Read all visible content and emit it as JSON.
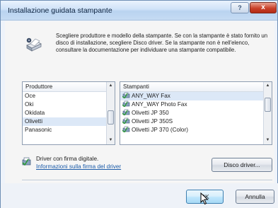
{
  "window": {
    "title": "Installazione guidata stampante",
    "help_label": "?",
    "close_label": "x"
  },
  "intro_text": "Scegliere produttore e modello della stampante. Se con la stampante è stato fornito un disco di installazione, scegliere Disco driver. Se la stampante non è nell'elenco, consultare la documentazione per individuare una stampante compatibile.",
  "manufacturers": {
    "header": "Produttore",
    "items": [
      "Oce",
      "Oki",
      "Okidata",
      "Olivetti",
      "Panasonic"
    ],
    "selected": "Olivetti"
  },
  "printers": {
    "header": "Stampanti",
    "items": [
      "ANY_WAY Fax",
      "ANY_WAY Photo Fax",
      "Olivetti JP 350",
      "Olivetti JP 350S",
      "Olivetti JP 370 (Color)"
    ],
    "selected": "ANY_WAY Fax"
  },
  "driver": {
    "signed_text": "Driver con firma digitale.",
    "link_text": "Informazioni sulla firma del driver",
    "disk_button": "Disco driver..."
  },
  "buttons": {
    "ok": "OK",
    "cancel": "Annulla"
  }
}
